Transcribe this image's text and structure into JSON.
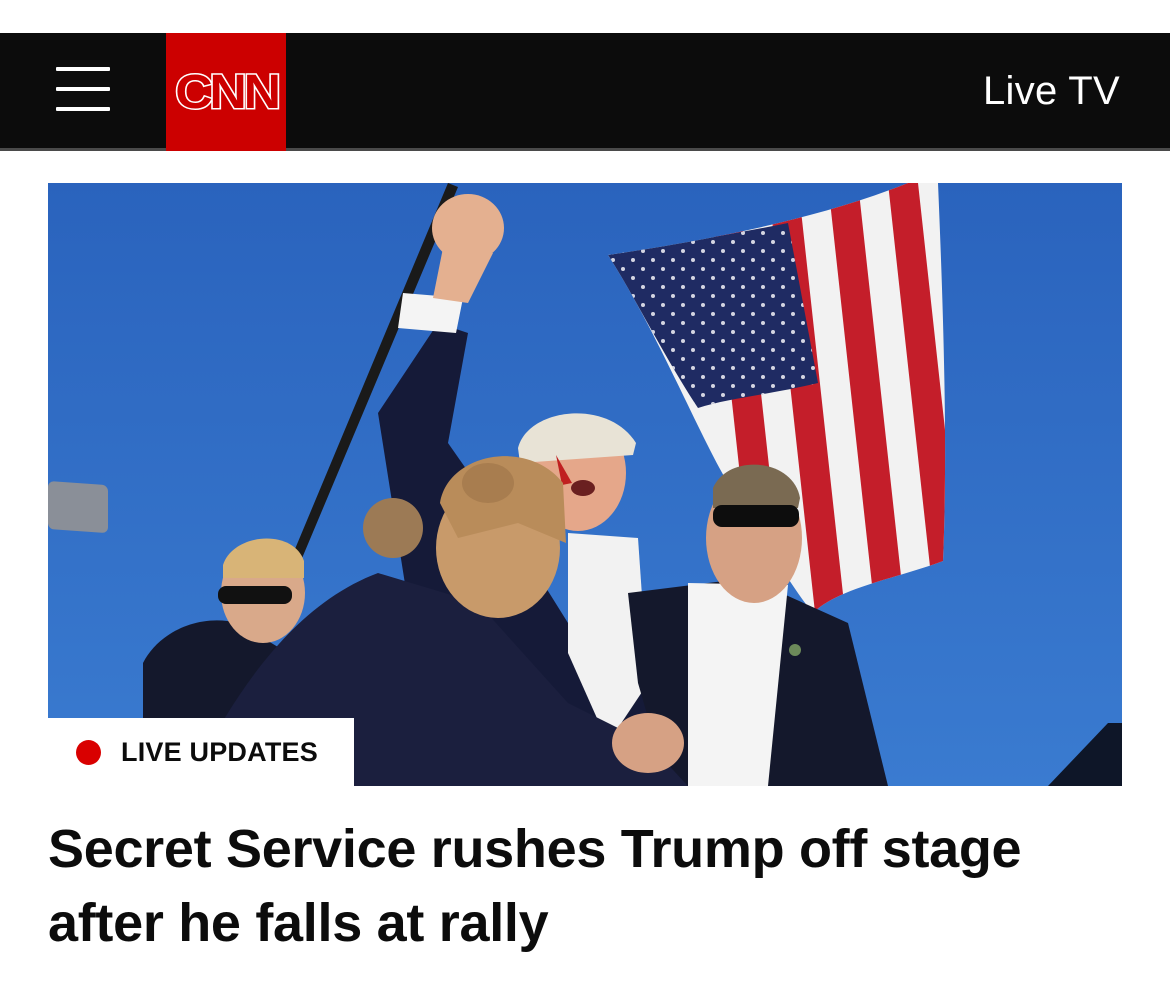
{
  "header": {
    "menu_icon": "hamburger-menu-icon",
    "logo_text": "CNN",
    "live_tv_label": "Live TV"
  },
  "hero": {
    "badge_label": "LIVE UPDATES",
    "badge_dot_color": "#d90000"
  },
  "article": {
    "headline": "Secret Service rushes Trump off stage after he falls at rally"
  },
  "colors": {
    "header_bg": "#0c0c0c",
    "brand_red": "#cc0000",
    "sky_blue": "#2f6fc6"
  }
}
